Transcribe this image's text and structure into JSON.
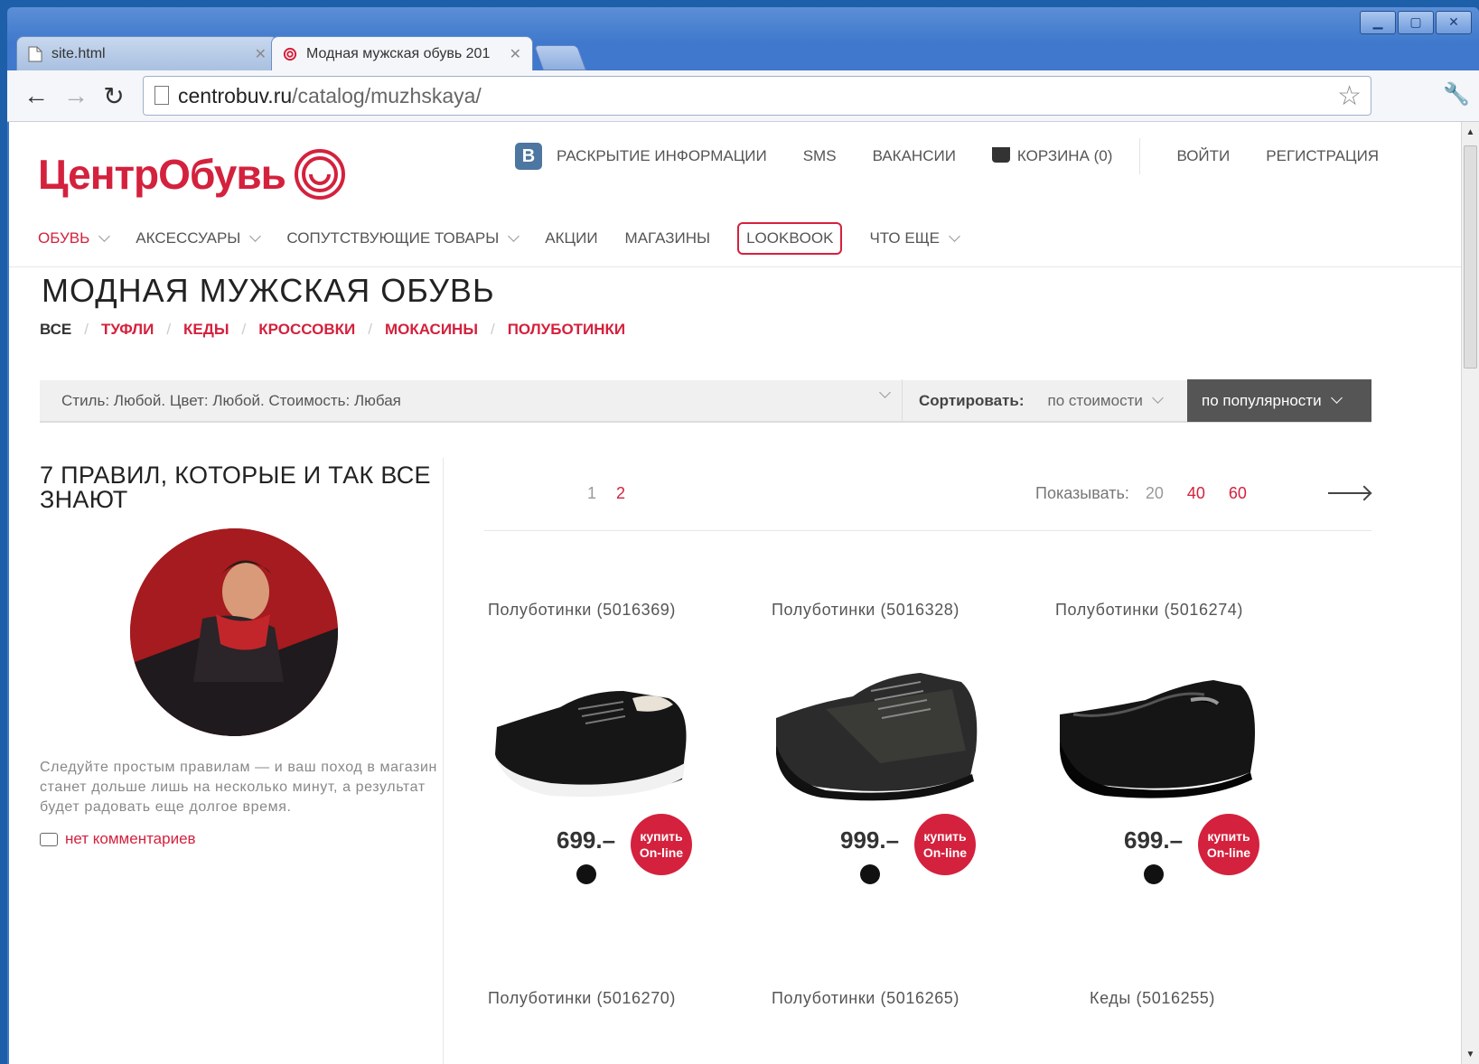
{
  "browser": {
    "tabs": [
      {
        "label": "site.html",
        "active": false
      },
      {
        "label": "Модная мужская обувь 201",
        "active": true
      }
    ],
    "url_host": "centrobuv.ru",
    "url_path": "/catalog/muzhskaya/"
  },
  "site": {
    "logo": "ЦентрОбувь",
    "brand_color": "#d4213d",
    "top_nav": {
      "disclosure": "РАСКРЫТИЕ ИНФОРМАЦИИ",
      "sms": "SMS",
      "vacancies": "ВАКАНСИИ",
      "cart": "КОРЗИНА (0)",
      "login": "ВОЙТИ",
      "register": "РЕГИСТРАЦИЯ"
    },
    "main_nav": {
      "shoes": "ОБУВЬ",
      "accessories": "АКСЕССУАРЫ",
      "related": "СОПУТСТВУЮЩИЕ ТОВАРЫ",
      "promo": "АКЦИИ",
      "stores": "МАГАЗИНЫ",
      "lookbook": "LOOKBOOK",
      "more": "ЧТО ЕЩЕ"
    }
  },
  "page": {
    "title": "МОДНАЯ МУЖСКАЯ ОБУВЬ",
    "categories": [
      "ВСЕ",
      "ТУФЛИ",
      "КЕДЫ",
      "КРОССОВКИ",
      "МОКАСИНЫ",
      "ПОЛУБОТИНКИ"
    ],
    "filter_text": "Стиль: Любой. Цвет: Любой. Стоимость: Любая",
    "sort_label": "Сортировать:",
    "sort_price": "по стоимости",
    "sort_popular": "по популярности"
  },
  "article": {
    "title": "7 ПРАВИЛ, КОТОРЫЕ И ТАК ВСЕ ЗНАЮТ",
    "text": "Следуйте простым правилам — и ваш поход в магазин станет дольше лишь на несколько минут, а результат будет радовать еще долгое время.",
    "comments": "нет комментариев"
  },
  "listing": {
    "pages": [
      "1",
      "2"
    ],
    "show_label": "Показывать:",
    "show_options": [
      "20",
      "40",
      "60"
    ]
  },
  "products": [
    {
      "name": "Полуботинки (5016369)",
      "price": "699.–",
      "buy1": "купить",
      "buy2": "On-line"
    },
    {
      "name": "Полуботинки (5016328)",
      "price": "999.–",
      "buy1": "купить",
      "buy2": "On-line"
    },
    {
      "name": "Полуботинки (5016274)",
      "price": "699.–",
      "buy1": "купить",
      "buy2": "On-line"
    },
    {
      "name": "Полуботинки (5016270)"
    },
    {
      "name": "Полуботинки (5016265)"
    },
    {
      "name": "Кеды (5016255)"
    }
  ]
}
